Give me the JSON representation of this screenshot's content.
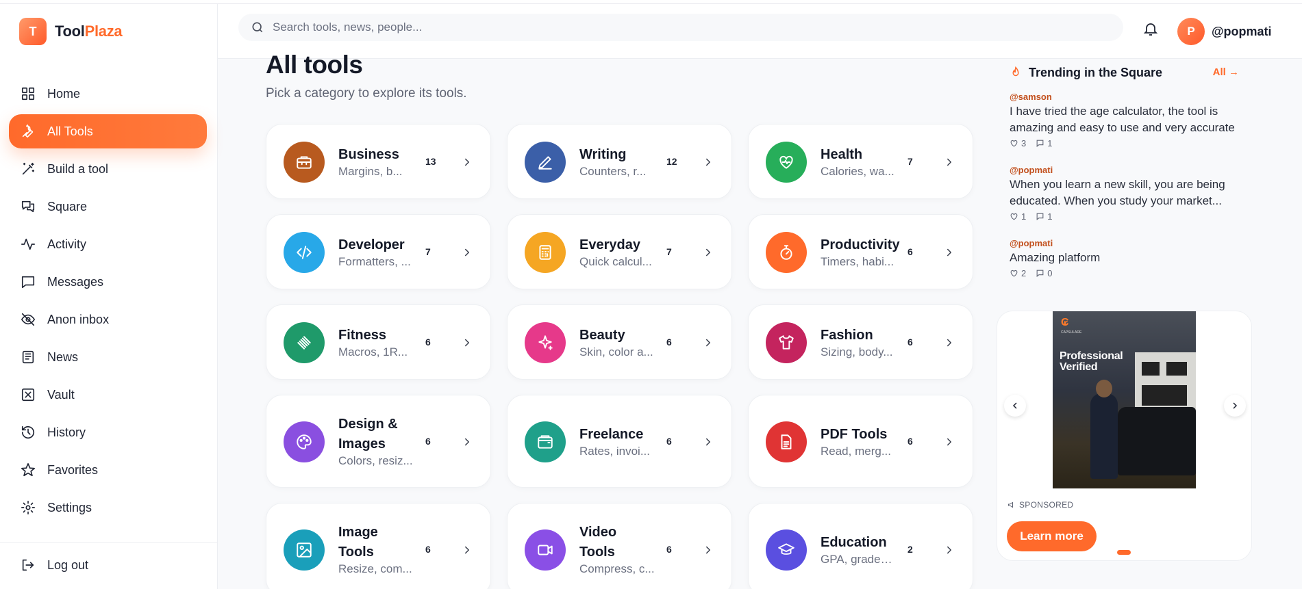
{
  "brand": {
    "logo_letter": "T",
    "name_part1": "Tool",
    "name_part2": "Plaza",
    "accent": "#ff6a2b"
  },
  "header": {
    "search_placeholder": "Search tools, news, people...",
    "avatar_letter": "P",
    "username": "@popmati"
  },
  "sidebar": {
    "items": [
      {
        "label": "Home",
        "icon": "grid-icon"
      },
      {
        "label": "All Tools",
        "icon": "wrench-icon",
        "active": true
      },
      {
        "label": "Build a tool",
        "icon": "magic-wand-icon"
      },
      {
        "label": "Square",
        "icon": "chat-bubbles-icon"
      },
      {
        "label": "Activity",
        "icon": "activity-icon"
      },
      {
        "label": "Messages",
        "icon": "message-icon"
      },
      {
        "label": "Anon inbox",
        "icon": "eye-off-icon"
      },
      {
        "label": "News",
        "icon": "newspaper-icon"
      },
      {
        "label": "Vault",
        "icon": "vault-icon"
      },
      {
        "label": "History",
        "icon": "history-icon"
      },
      {
        "label": "Favorites",
        "icon": "star-icon"
      },
      {
        "label": "Settings",
        "icon": "gear-icon"
      }
    ],
    "logout_label": "Log out"
  },
  "main": {
    "title": "All tools",
    "subtitle": "Pick a category to explore its tools.",
    "categories": [
      {
        "name": "Business",
        "desc": "Margins, b...",
        "count": "13",
        "color": "#b85a1f",
        "icon": "briefcase-icon"
      },
      {
        "name": "Writing",
        "desc": "Counters, r...",
        "count": "12",
        "color": "#3b5fa8",
        "icon": "pen-icon"
      },
      {
        "name": "Health",
        "desc": "Calories, wa...",
        "count": "7",
        "color": "#27ae5a",
        "icon": "heart-pulse-icon"
      },
      {
        "name": "Developer",
        "desc": "Formatters, ...",
        "count": "7",
        "color": "#28a8e8",
        "icon": "code-icon"
      },
      {
        "name": "Everyday",
        "desc": "Quick calcul...",
        "count": "7",
        "color": "#f5a623",
        "icon": "calculator-icon"
      },
      {
        "name": "Productivity",
        "desc": "Timers, habi...",
        "count": "6",
        "color": "#ff6a2b",
        "icon": "timer-icon"
      },
      {
        "name": "Fitness",
        "desc": "Macros, 1R...",
        "count": "6",
        "color": "#1f9a6a",
        "icon": "dumbbell-icon"
      },
      {
        "name": "Beauty",
        "desc": "Skin, color a...",
        "count": "6",
        "color": "#e6398a",
        "icon": "sparkles-icon"
      },
      {
        "name": "Fashion",
        "desc": "Sizing, body...",
        "count": "6",
        "color": "#c4245e",
        "icon": "shirt-icon"
      },
      {
        "name": "Design & Images",
        "desc": "Colors, resiz...",
        "count": "6",
        "color": "#8a4fe0",
        "icon": "palette-icon"
      },
      {
        "name": "Freelance",
        "desc": "Rates, invoi...",
        "count": "6",
        "color": "#1fa08a",
        "icon": "wallet-icon"
      },
      {
        "name": "PDF Tools",
        "desc": "Read, merg...",
        "count": "6",
        "color": "#e03434",
        "icon": "file-text-icon"
      },
      {
        "name": "Image Tools",
        "desc": "Resize, com...",
        "count": "6",
        "color": "#1a9fba",
        "icon": "image-icon"
      },
      {
        "name": "Video Tools",
        "desc": "Compress, c...",
        "count": "6",
        "color": "#8a4fe6",
        "icon": "video-icon"
      },
      {
        "name": "Education",
        "desc": "GPA, grades...",
        "count": "2",
        "color": "#5a4fe0",
        "icon": "graduation-cap-icon"
      }
    ]
  },
  "trending": {
    "title": "Trending in the Square",
    "all_label": "All",
    "posts": [
      {
        "user": "@samson",
        "body": "I have tried the age calculator, the tool is amazing and easy to use and very accurate",
        "likes": "3",
        "comments": "1"
      },
      {
        "user": "@popmati",
        "body": "When you learn a new skill, you are being educated. When you study your market...",
        "likes": "1",
        "comments": "1"
      },
      {
        "user": "@popmati",
        "body": "Amazing platform",
        "likes": "2",
        "comments": "0"
      }
    ]
  },
  "ad": {
    "image_text_line1": "Professional",
    "image_text_line2": "Verified",
    "image_brand": "CAPSULARE",
    "sponsored_label": "SPONSORED",
    "cta_label": "Learn more"
  }
}
